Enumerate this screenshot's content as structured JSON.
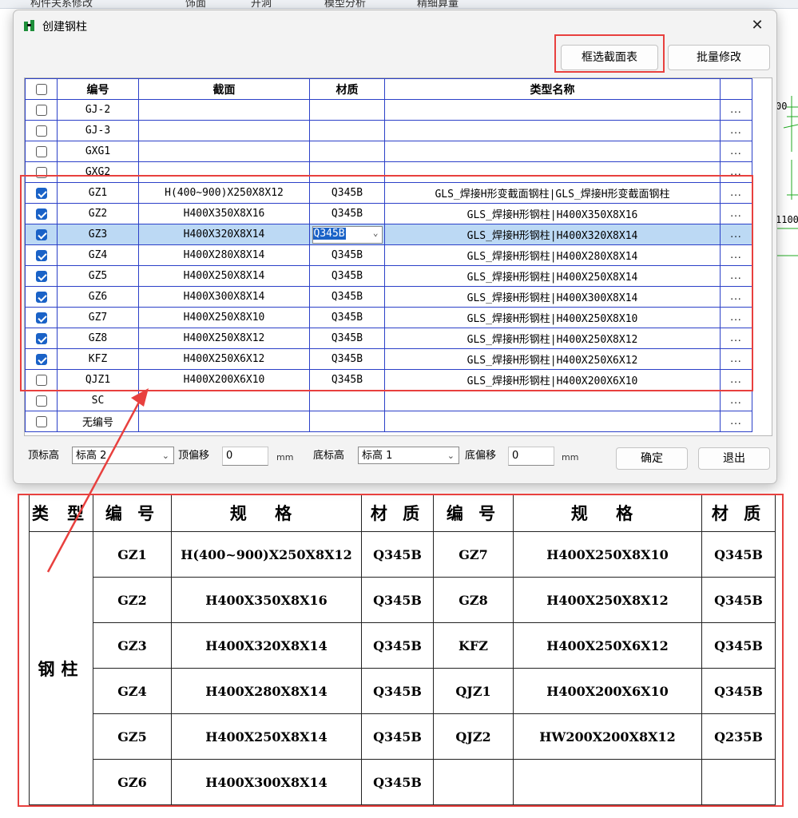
{
  "background": {
    "menubar": [
      "构件关系修改",
      "饰面",
      "开洞",
      "模型分析",
      "精细算量"
    ],
    "cad_labels": [
      "00",
      "1100"
    ]
  },
  "dialog": {
    "title": "创建钢柱",
    "close_symbol": "✕",
    "buttons": {
      "select_section_table": "框选截面表",
      "batch_modify": "批量修改",
      "ok": "确定",
      "exit": "退出"
    },
    "grid": {
      "headers": [
        "编号",
        "截面",
        "材质",
        "类型名称"
      ],
      "more_symbol": "...",
      "rows": [
        {
          "checked": false,
          "code": "GJ-2",
          "section": "",
          "material": "",
          "type_name": ""
        },
        {
          "checked": false,
          "code": "GJ-3",
          "section": "",
          "material": "",
          "type_name": ""
        },
        {
          "checked": false,
          "code": "GXG1",
          "section": "",
          "material": "",
          "type_name": ""
        },
        {
          "checked": false,
          "code": "GXG2",
          "section": "",
          "material": "",
          "type_name": ""
        },
        {
          "checked": true,
          "code": "GZ1",
          "section": "H(400~900)X250X8X12",
          "material": "Q345B",
          "type_name": "GLS_焊接H形变截面钢柱|GLS_焊接H形变截面钢柱"
        },
        {
          "checked": true,
          "code": "GZ2",
          "section": "H400X350X8X16",
          "material": "Q345B",
          "type_name": "GLS_焊接H形钢柱|H400X350X8X16"
        },
        {
          "checked": true,
          "code": "GZ3",
          "section": "H400X320X8X14",
          "material": "Q345B",
          "type_name": "GLS_焊接H形钢柱|H400X320X8X14",
          "selected": true
        },
        {
          "checked": true,
          "code": "GZ4",
          "section": "H400X280X8X14",
          "material": "Q345B",
          "type_name": "GLS_焊接H形钢柱|H400X280X8X14"
        },
        {
          "checked": true,
          "code": "GZ5",
          "section": "H400X250X8X14",
          "material": "Q345B",
          "type_name": "GLS_焊接H形钢柱|H400X250X8X14"
        },
        {
          "checked": true,
          "code": "GZ6",
          "section": "H400X300X8X14",
          "material": "Q345B",
          "type_name": "GLS_焊接H形钢柱|H400X300X8X14"
        },
        {
          "checked": true,
          "code": "GZ7",
          "section": "H400X250X8X10",
          "material": "Q345B",
          "type_name": "GLS_焊接H形钢柱|H400X250X8X10"
        },
        {
          "checked": true,
          "code": "GZ8",
          "section": "H400X250X8X12",
          "material": "Q345B",
          "type_name": "GLS_焊接H形钢柱|H400X250X8X12"
        },
        {
          "checked": true,
          "code": "KFZ",
          "section": "H400X250X6X12",
          "material": "Q345B",
          "type_name": "GLS_焊接H形钢柱|H400X250X6X12"
        },
        {
          "checked": false,
          "code": "QJZ1",
          "section": "H400X200X6X10",
          "material": "Q345B",
          "type_name": "GLS_焊接H形钢柱|H400X200X6X10"
        },
        {
          "checked": false,
          "code": "SC",
          "section": "",
          "material": "",
          "type_name": ""
        },
        {
          "checked": false,
          "code": "无编号",
          "section": "",
          "material": "",
          "type_name": ""
        }
      ]
    },
    "bottom": {
      "top_elev_label": "顶标高",
      "top_elev_value": "标高 2",
      "top_offset_label": "顶偏移",
      "top_offset_value": "0",
      "bottom_elev_label": "底标高",
      "bottom_elev_value": "标高 1",
      "bottom_offset_label": "底偏移",
      "bottom_offset_value": "0",
      "unit": "mm"
    }
  },
  "cad_table": {
    "headers": {
      "type": "类 型",
      "code": "编 号",
      "spec": "规 格",
      "material": "材 质"
    },
    "type_value": "钢柱",
    "left": [
      {
        "code": "GZ1",
        "spec": "H(400~900)X250X8X12",
        "material": "Q345B"
      },
      {
        "code": "GZ2",
        "spec": "H400X350X8X16",
        "material": "Q345B"
      },
      {
        "code": "GZ3",
        "spec": "H400X320X8X14",
        "material": "Q345B"
      },
      {
        "code": "GZ4",
        "spec": "H400X280X8X14",
        "material": "Q345B"
      },
      {
        "code": "GZ5",
        "spec": "H400X250X8X14",
        "material": "Q345B"
      },
      {
        "code": "GZ6",
        "spec": "H400X300X8X14",
        "material": "Q345B"
      }
    ],
    "right": [
      {
        "code": "GZ7",
        "spec": "H400X250X8X10",
        "material": "Q345B"
      },
      {
        "code": "GZ8",
        "spec": "H400X250X8X12",
        "material": "Q345B"
      },
      {
        "code": "KFZ",
        "spec": "H400X250X6X12",
        "material": "Q345B"
      },
      {
        "code": "QJZ1",
        "spec": "H400X200X6X10",
        "material": "Q345B"
      },
      {
        "code": "QJZ2",
        "spec": "HW200X200X8X12",
        "material": "Q235B"
      },
      {
        "code": "",
        "spec": "",
        "material": ""
      }
    ]
  },
  "colors": {
    "annotation_red": "#e8403e",
    "grid_blue": "#2b40c8",
    "selection": "#bcd9f4",
    "check_blue": "#1a62c7"
  }
}
